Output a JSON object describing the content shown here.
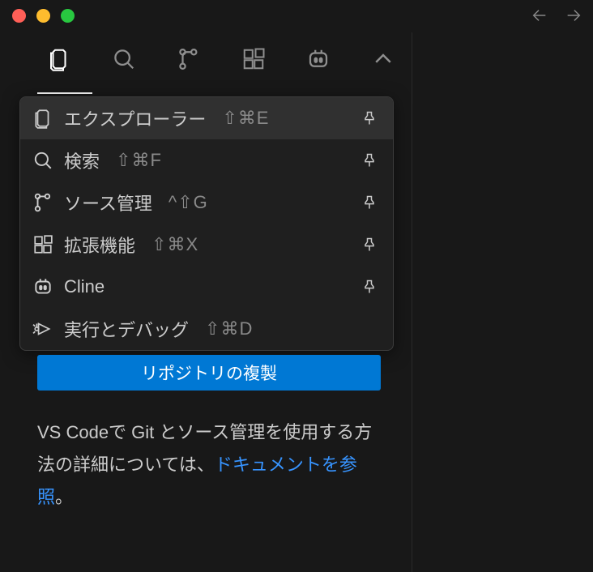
{
  "activity": {
    "items": [
      {
        "name": "explorer"
      },
      {
        "name": "search"
      },
      {
        "name": "source-control"
      },
      {
        "name": "extensions"
      },
      {
        "name": "cline"
      },
      {
        "name": "overflow"
      }
    ]
  },
  "menu": {
    "items": [
      {
        "label": "エクスプローラー",
        "shortcut": "⇧⌘E"
      },
      {
        "label": "検索",
        "shortcut": "⇧⌘F"
      },
      {
        "label": "ソース管理",
        "shortcut": "^⇧G"
      },
      {
        "label": "拡張機能",
        "shortcut": "⇧⌘X"
      },
      {
        "label": "Cline",
        "shortcut": ""
      },
      {
        "label": "実行とデバッグ",
        "shortcut": "⇧⌘D"
      }
    ]
  },
  "sidebar": {
    "clone_button": "リポジトリの複製",
    "info_prefix": "VS Codeで Git とソース管理を使用する方法の詳細については、",
    "info_link": "ドキュメントを参照",
    "info_suffix": "。"
  }
}
